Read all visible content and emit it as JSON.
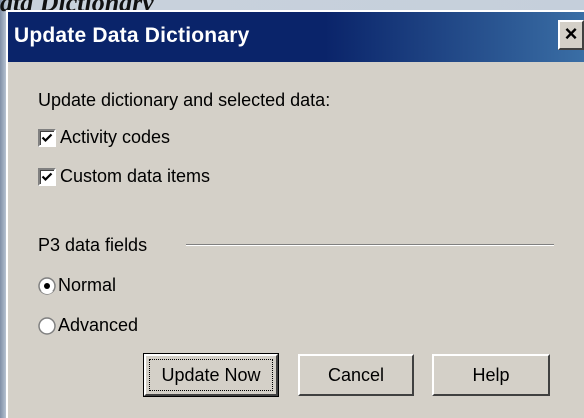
{
  "background": {
    "caption": "ata Dictionary"
  },
  "dialog": {
    "title": "Update Data Dictionary",
    "close_label": "×",
    "prompt": "Update dictionary and selected data:",
    "checkboxes": [
      {
        "label": "Activity codes",
        "checked": true
      },
      {
        "label": "Custom data items",
        "checked": true
      }
    ],
    "group_label": "P3 data fields",
    "radios": [
      {
        "label": "Normal",
        "selected": true
      },
      {
        "label": "Advanced",
        "selected": false
      }
    ],
    "buttons": {
      "update_now": "Update Now",
      "cancel": "Cancel",
      "help": "Help"
    }
  },
  "colors": {
    "titlebar": "#0a246a",
    "dialog_face": "#d4d0c8"
  },
  "icons": {
    "close": "close-icon",
    "checkmark": "checkmark-icon",
    "radio_selected": "radio-selected-icon",
    "radio_unselected": "radio-unselected-icon"
  }
}
